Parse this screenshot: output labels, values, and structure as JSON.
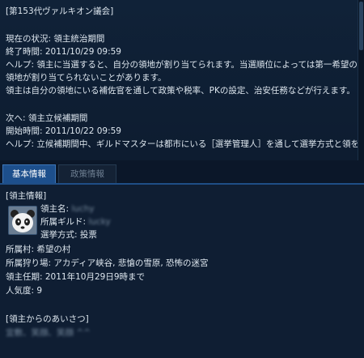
{
  "election": {
    "header": "[第153代ヴァルキオン議会]",
    "current_status": "現在の状況: 領主統治期間",
    "end_time": "終了時間: 2011/10/29 09:59",
    "help_line1": "ヘルプ: 領主に当選すると、自分の領地が割り当てられます。当選順位によっては第一希望の",
    "help_line2": "領地が割り当てられないことがあります。",
    "help_line3": "領主は自分の領地にいる補佐官を通して政策や税率、PKの設定、治安任務などが行えます。",
    "next_phase": "次へ: 領主立候補期間",
    "start_time": "開始時間: 2011/10/22 09:59",
    "help_line4": "ヘルプ: 立候補期間中、ギルドマスターは都市にいる［選挙管理人］を通して選挙方式と領を"
  },
  "tabs": [
    {
      "label": "基本情報",
      "active": true
    },
    {
      "label": "政策情報",
      "active": false
    }
  ],
  "lord_info": {
    "section_title": "[領主情報]",
    "name_label": "領主名:",
    "name_value": "luchy",
    "guild_label": "所属ギルド:",
    "guild_value": "lucky",
    "election_method": "選挙方式: 投票",
    "village": "所属村: 希望の村",
    "hunting_grounds": "所属狩り場: アカディア峡谷, 悲愴の雪原, 恐怖の迷宮",
    "term": "領主任期: 2011年10月29日9時まで",
    "popularity": "人気度: 9"
  },
  "greeting": {
    "section_title": "[領主からのあいさつ]",
    "message": "宜敷、笑顔、笑顔 ^^"
  },
  "colors": {
    "accent": "#1d4f8c",
    "background": "#0c1a2c",
    "text": "#dde6ee"
  }
}
